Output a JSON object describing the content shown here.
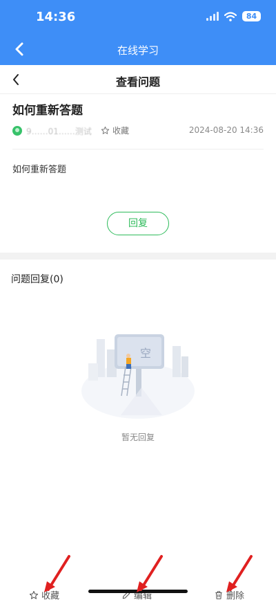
{
  "status_bar": {
    "time": "14:36",
    "battery": "84"
  },
  "app_bar": {
    "title": "在线学习"
  },
  "page": {
    "title": "查看问题"
  },
  "question": {
    "title": "如何重新答题",
    "author": "9……01……测试",
    "favorite_label": "收藏",
    "time": "2024-08-20 14:36",
    "body": "如何重新答题"
  },
  "reply_button": {
    "label": "回复"
  },
  "replies": {
    "title": "问题回复(0)",
    "empty_text": "暂无回复",
    "illustration_text": "空"
  },
  "bottom_bar": {
    "favorite": "收藏",
    "edit": "编辑",
    "delete": "删除"
  },
  "colors": {
    "accent": "#3e8ef7",
    "green": "#2dbb5a",
    "annotation": "#e02020"
  }
}
